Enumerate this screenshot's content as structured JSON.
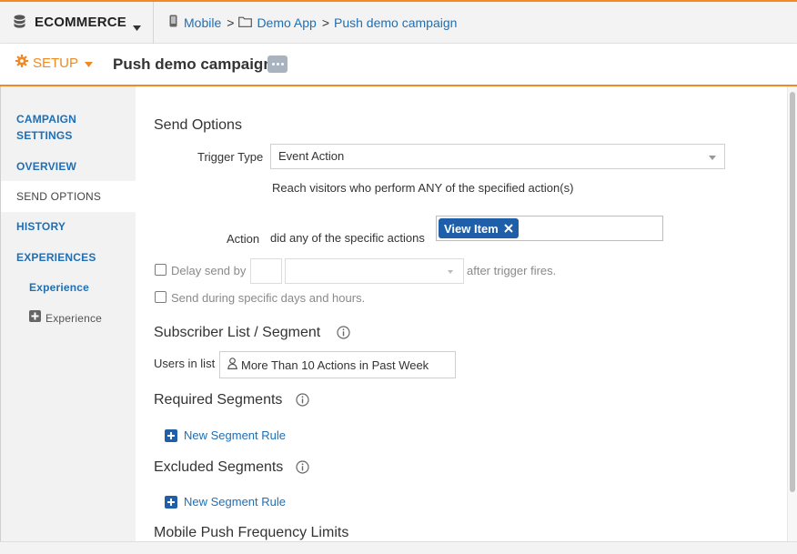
{
  "topbar": {
    "app_name": "ECOMMERCE",
    "breadcrumb": [
      {
        "label": "Mobile",
        "icon": "phone-icon"
      },
      {
        "label": "Demo App",
        "icon": "folder-icon"
      },
      {
        "label": "Push demo campaign"
      }
    ],
    "separator": ">"
  },
  "setupbar": {
    "setup_label": "SETUP",
    "campaign_title": "Push demo campaign"
  },
  "sidenav": {
    "items": [
      {
        "label": "CAMPAIGN SETTINGS"
      },
      {
        "label": "OVERVIEW"
      },
      {
        "label": "SEND OPTIONS"
      },
      {
        "label": "HISTORY"
      },
      {
        "label": "EXPERIENCES"
      },
      {
        "label": "Experience"
      },
      {
        "label": "Experience"
      }
    ]
  },
  "send_options": {
    "title": "Send Options",
    "trigger_label": "Trigger Type",
    "trigger_value": "Event Action",
    "trigger_note": "Reach visitors who perform ANY of the specified action(s)",
    "action_label": "Action",
    "action_desc": "did any of the specific actions",
    "action_tag": "View Item",
    "delay_label": "Delay send by",
    "delay_suffix": "after trigger fires.",
    "schedule_label": "Send during specific days and hours."
  },
  "subscriber": {
    "title": "Subscriber List / Segment",
    "users_label": "Users in list",
    "list_value": "More Than 10 Actions in Past Week"
  },
  "required": {
    "title": "Required Segments",
    "add_label": "New Segment Rule"
  },
  "excluded": {
    "title": "Excluded Segments",
    "add_label": "New Segment Rule"
  },
  "frequency": {
    "title": "Mobile Push Frequency Limits"
  },
  "colors": {
    "accent": "#f08a24",
    "link": "#1f6fb5",
    "tag_bg": "#1f5ea8"
  }
}
